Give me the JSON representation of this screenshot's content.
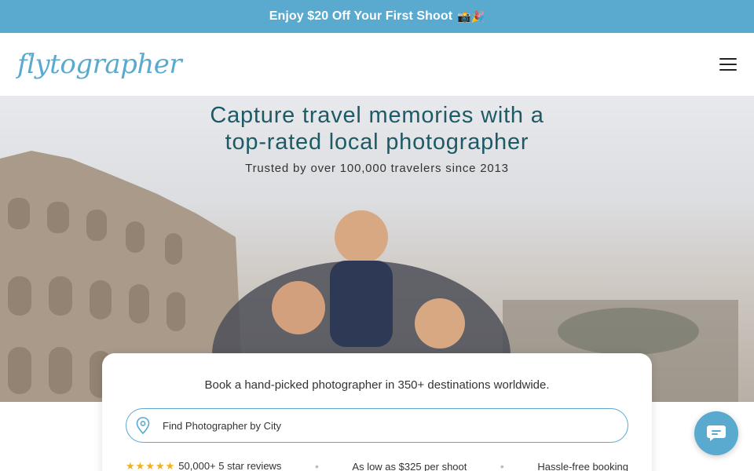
{
  "promo": {
    "text": "Enjoy $20 Off Your First Shoot",
    "emoji": "📸🎉"
  },
  "header": {
    "logo_text": "flytographer"
  },
  "hero": {
    "title_line1": "Capture travel memories with a",
    "title_line2": "top-rated local photographer",
    "subtitle": "Trusted by over 100,000 travelers since 2013"
  },
  "search": {
    "tagline": "Book a hand-picked photographer in 350+ destinations worldwide.",
    "placeholder": "Find Photographer by City"
  },
  "trust": {
    "reviews": "50,000+ 5 star reviews",
    "price": "As low as $325 per shoot",
    "booking": "Hassle-free booking",
    "separator": "•"
  },
  "colors": {
    "accent": "#5aa9cf",
    "title": "#1d5a66",
    "star": "#f2b01e"
  }
}
